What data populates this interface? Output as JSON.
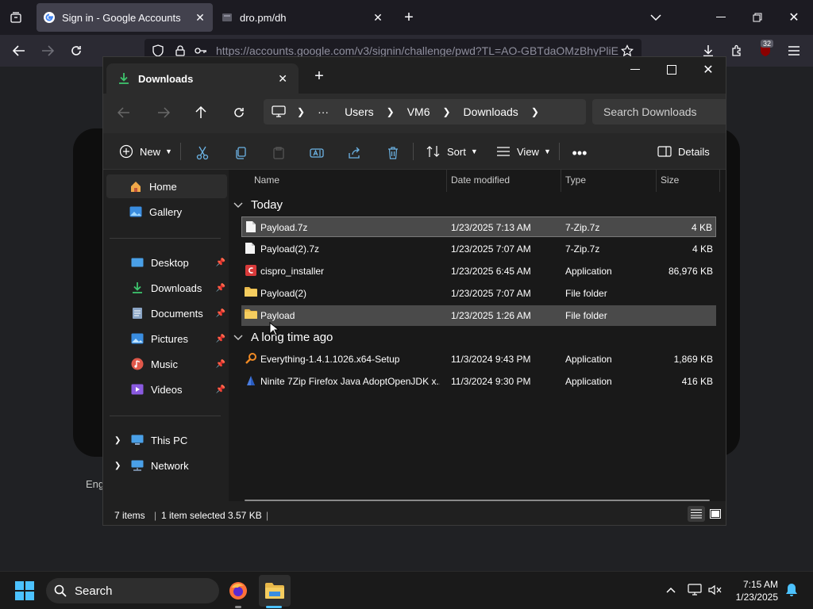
{
  "browser": {
    "tabs": [
      {
        "title": "Sign in - Google Accounts",
        "active": true
      },
      {
        "title": "dro.pm/dh",
        "active": false
      }
    ],
    "url": "https://accounts.google.com/v3/signin/challenge/pwd?TL=AO-GBTdaOMzBhyPliE",
    "downloads_badge": "32",
    "page_language": "Eng"
  },
  "explorer": {
    "tab_title": "Downloads",
    "breadcrumbs": [
      "Users",
      "VM6",
      "Downloads"
    ],
    "search_placeholder": "Search Downloads",
    "commands": {
      "new": "New",
      "sort": "Sort",
      "view": "View",
      "details": "Details"
    },
    "nav": {
      "home": "Home",
      "gallery": "Gallery",
      "pinned": [
        "Desktop",
        "Downloads",
        "Documents",
        "Pictures",
        "Music",
        "Videos"
      ],
      "this_pc": "This PC",
      "network": "Network"
    },
    "columns": [
      "Name",
      "Date modified",
      "Type",
      "Size"
    ],
    "groups": [
      {
        "label": "Today",
        "files": [
          {
            "name": "Payload.7z",
            "date": "1/23/2025 7:13 AM",
            "type": "7-Zip.7z",
            "size": "4 KB",
            "icon": "doc-icon"
          },
          {
            "name": "Payload(2).7z",
            "date": "1/23/2025 7:07 AM",
            "type": "7-Zip.7z",
            "size": "4 KB",
            "icon": "doc-icon"
          },
          {
            "name": "cispro_installer",
            "date": "1/23/2025 6:45 AM",
            "type": "Application",
            "size": "86,976 KB",
            "icon": "app-red-icon"
          },
          {
            "name": "Payload(2)",
            "date": "1/23/2025 7:07 AM",
            "type": "File folder",
            "size": "",
            "icon": "folder-icon"
          },
          {
            "name": "Payload",
            "date": "1/23/2025 1:26 AM",
            "type": "File folder",
            "size": "",
            "icon": "folder-icon"
          }
        ]
      },
      {
        "label": "A long time ago",
        "files": [
          {
            "name": "Everything-1.4.1.1026.x64-Setup",
            "date": "11/3/2024 9:43 PM",
            "type": "Application",
            "size": "1,869 KB",
            "icon": "magnifier-icon"
          },
          {
            "name": "Ninite 7Zip Firefox Java AdoptOpenJDK x...",
            "date": "11/3/2024 9:30 PM",
            "type": "Application",
            "size": "416 KB",
            "icon": "ninite-icon"
          }
        ]
      }
    ],
    "status": {
      "items": "7 items",
      "selected": "1 item selected",
      "size": "3.57 KB"
    }
  },
  "taskbar": {
    "search": "Search",
    "time": "7:15 AM",
    "date": "1/23/2025"
  },
  "colors": {
    "accent": "#0a84ff",
    "folder": "#e8b84a",
    "download_green": "#3ec46d"
  }
}
